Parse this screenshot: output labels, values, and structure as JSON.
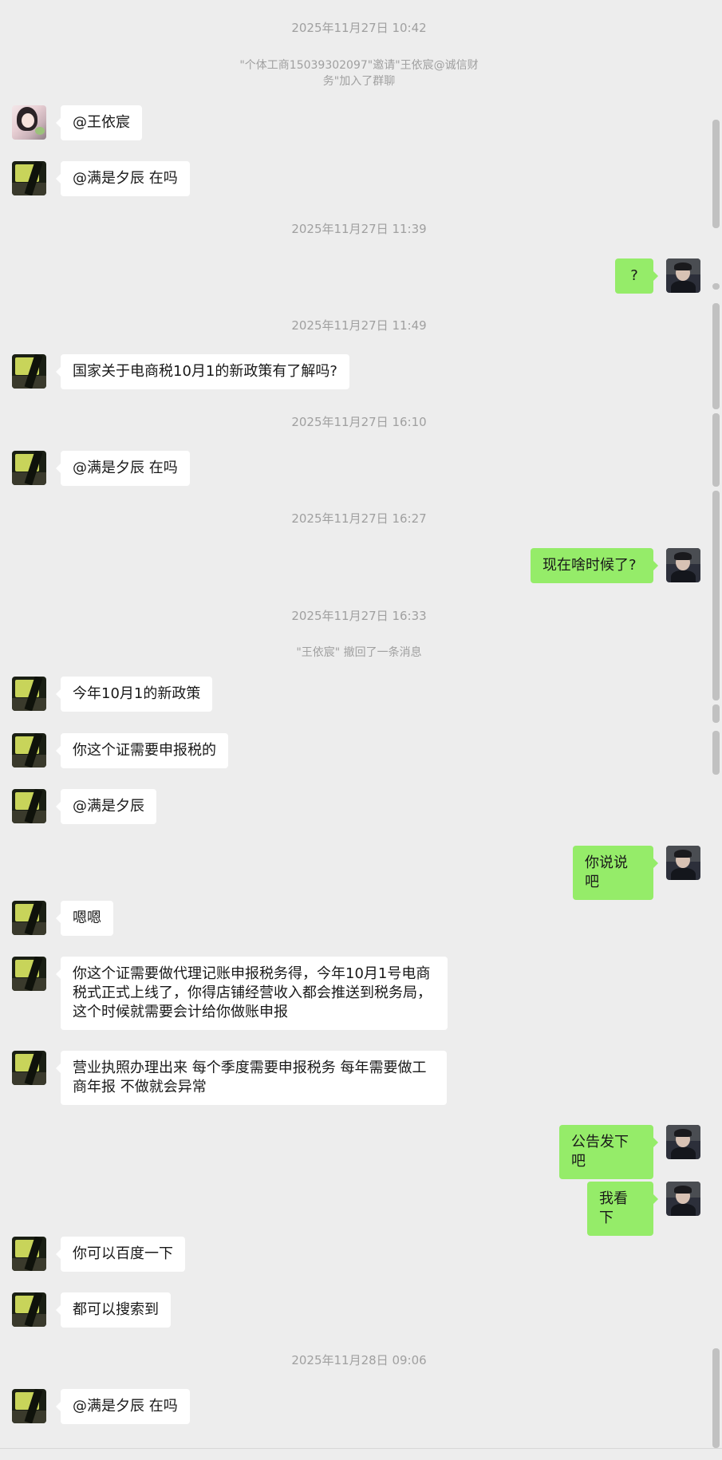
{
  "timestamps": [
    "2025年11月27日 10:42",
    "2025年11月27日 11:39",
    "2025年11月27日 11:49",
    "2025年11月27日 16:10",
    "2025年11月27日 16:27",
    "2025年11月27日 16:33",
    "2025年11月28日 09:06"
  ],
  "system": {
    "invite": "\"个体工商15039302097\"邀请\"王依宸@诚信财务\"加入了群聊",
    "recall": "\"王依宸\" 撤回了一条消息"
  },
  "messages": {
    "m1": "@王依宸",
    "m2": "@满是夕辰 在吗",
    "m3": "?",
    "m4": "国家关于电商税10月1的新政策有了解吗?",
    "m5": "@满是夕辰 在吗",
    "m6": "现在啥时候了?",
    "m7": "今年10月1的新政策",
    "m8": "你这个证需要申报税的",
    "m9": "@满是夕辰",
    "m10": "你说说吧",
    "m11": "嗯嗯",
    "m12": "你这个证需要做代理记账申报税务得，今年10月1号电商税式正式上线了，你得店铺经营收入都会推送到税务局，这个时候就需要会计给你做账申报",
    "m13": "营业执照办理出来  每个季度需要申报税务 每年需要做工商年报 不做就会异常",
    "m14": "公告发下吧",
    "m15": "我看下",
    "m16": "你可以百度一下",
    "m17": "都可以搜索到",
    "m18": "@满是夕辰 在吗"
  },
  "colors": {
    "background": "#ededed",
    "bubble_self": "#95ec69",
    "bubble_other": "#ffffff",
    "meta_text": "#a0a0a0"
  }
}
